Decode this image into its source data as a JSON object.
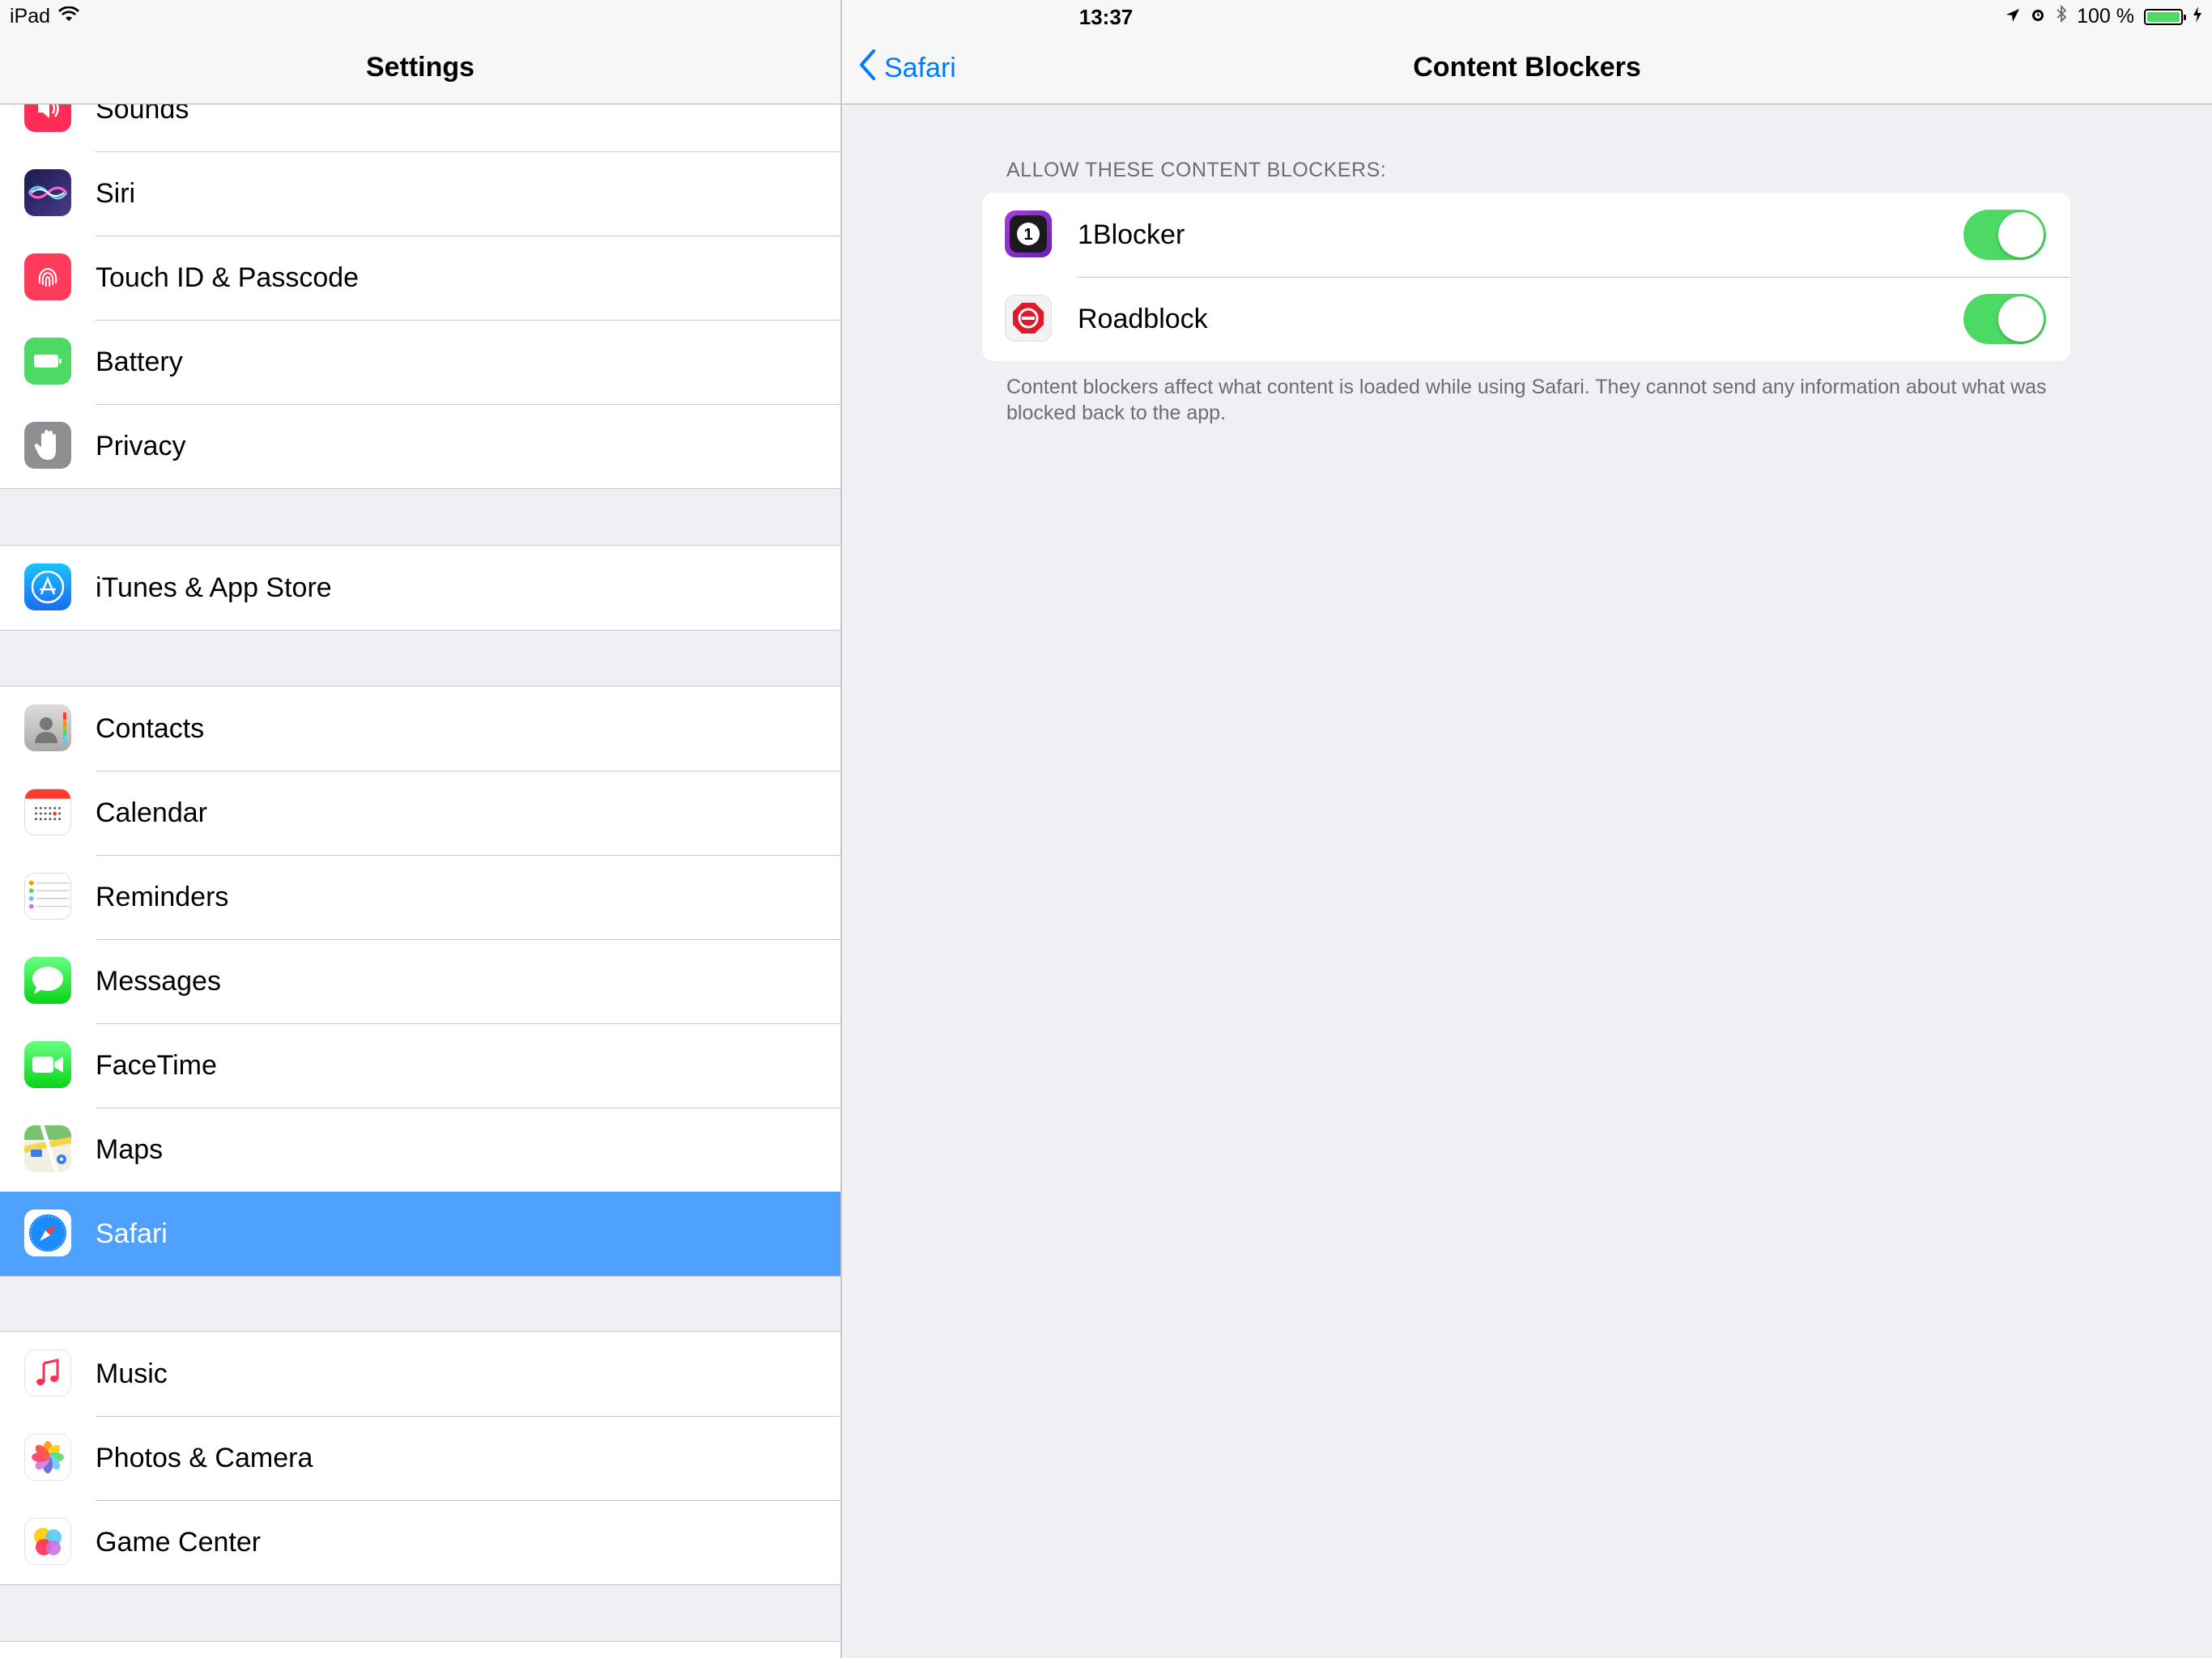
{
  "status_bar": {
    "device": "iPad",
    "time": "13:37",
    "battery_percent_text": "100 %",
    "battery_level": 1.0,
    "icons": [
      "wifi-icon",
      "location-icon",
      "alarm-icon",
      "bluetooth-icon",
      "battery-icon",
      "charging-icon"
    ]
  },
  "master": {
    "title": "Settings",
    "groups": [
      {
        "items": [
          {
            "label": "Sounds",
            "icon": "sounds-icon",
            "color": "#ff2d55"
          },
          {
            "label": "Siri",
            "icon": "siri-icon",
            "color": "#1a1a3a"
          },
          {
            "label": "Touch ID & Passcode",
            "icon": "fingerprint-icon",
            "color": "#ff3b5c"
          },
          {
            "label": "Battery",
            "icon": "battery-settings-icon",
            "color": "#4cd964"
          },
          {
            "label": "Privacy",
            "icon": "privacy-hand-icon",
            "color": "#8e8e93"
          }
        ]
      },
      {
        "items": [
          {
            "label": "iTunes & App Store",
            "icon": "app-store-icon",
            "color": "#1a8cff"
          }
        ]
      },
      {
        "items": [
          {
            "label": "Contacts",
            "icon": "contacts-icon",
            "color": "#9a9a9a"
          },
          {
            "label": "Calendar",
            "icon": "calendar-icon",
            "color": "#ff3b30"
          },
          {
            "label": "Reminders",
            "icon": "reminders-icon",
            "color": "#ff9500"
          },
          {
            "label": "Messages",
            "icon": "messages-icon",
            "color": "#4cd964"
          },
          {
            "label": "FaceTime",
            "icon": "facetime-icon",
            "color": "#4cd964"
          },
          {
            "label": "Maps",
            "icon": "maps-icon",
            "color": "#6ac3f0"
          },
          {
            "label": "Safari",
            "icon": "safari-icon",
            "color": "#1a8cff",
            "selected": true
          }
        ]
      },
      {
        "items": [
          {
            "label": "Music",
            "icon": "music-icon",
            "color": "#ff2d55"
          },
          {
            "label": "Photos & Camera",
            "icon": "photos-icon",
            "color": "#ff9500"
          },
          {
            "label": "Game Center",
            "icon": "game-center-icon",
            "color": "#5856d6"
          }
        ]
      }
    ]
  },
  "detail": {
    "back_label": "Safari",
    "title": "Content Blockers",
    "section_header": "ALLOW THESE CONTENT BLOCKERS:",
    "blockers": [
      {
        "label": "1Blocker",
        "icon": "1blocker-icon",
        "enabled": true
      },
      {
        "label": "Roadblock",
        "icon": "roadblock-icon",
        "enabled": true
      }
    ],
    "footer": "Content blockers affect what content is loaded while using Safari. They cannot send any information about what was blocked back to the app."
  },
  "colors": {
    "accent": "#007aff",
    "selection": "#4ea1fd",
    "toggle_on": "#4cd964",
    "background": "#efeff4"
  }
}
